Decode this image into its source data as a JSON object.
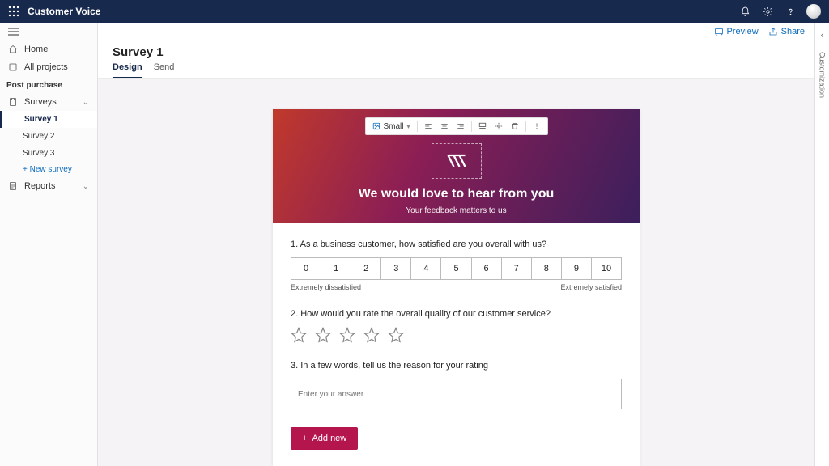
{
  "app": {
    "name": "Customer Voice"
  },
  "nav": {
    "home": "Home",
    "allProjects": "All projects",
    "section": "Post purchase",
    "surveys": "Surveys",
    "items": [
      "Survey 1",
      "Survey 2",
      "Survey 3"
    ],
    "newSurvey": "+ New survey",
    "reports": "Reports"
  },
  "commands": {
    "preview": "Preview",
    "share": "Share"
  },
  "page": {
    "title": "Survey 1",
    "tabs": {
      "design": "Design",
      "send": "Send"
    }
  },
  "toolbar": {
    "size": "Small"
  },
  "banner": {
    "title": "We would love to hear from you",
    "subtitle": "Your feedback matters to us"
  },
  "q1": {
    "text": "1. As a business customer, how satisfied are you overall with us?",
    "scale": [
      "0",
      "1",
      "2",
      "3",
      "4",
      "5",
      "6",
      "7",
      "8",
      "9",
      "10"
    ],
    "low": "Extremely dissatisfied",
    "high": "Extremely satisfied"
  },
  "q2": {
    "text": "2. How would you rate the overall quality of our customer service?"
  },
  "q3": {
    "text": "3. In a few words, tell us the reason for your rating",
    "placeholder": "Enter your answer"
  },
  "addNew": "Add new",
  "rail": {
    "label": "Customization"
  }
}
